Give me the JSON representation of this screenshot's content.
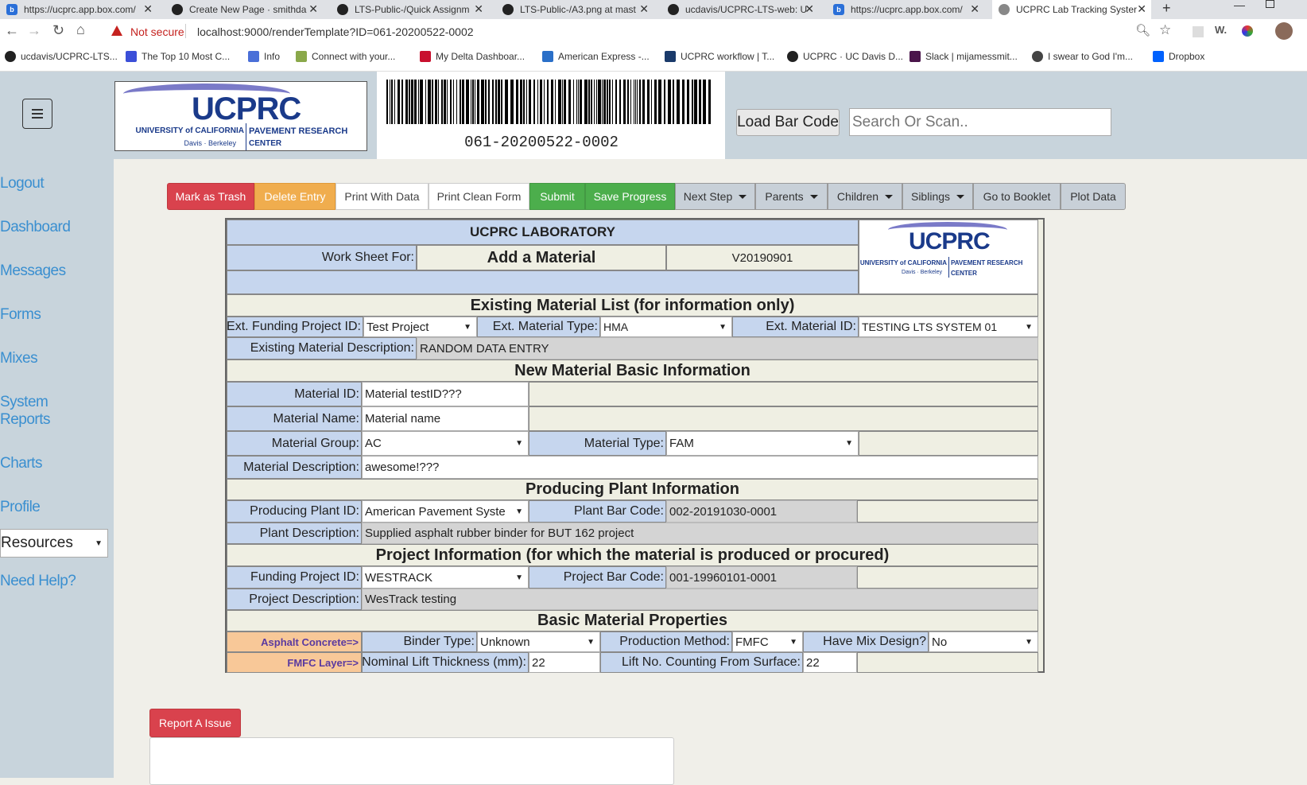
{
  "browser": {
    "tabs": [
      {
        "label": "https://ucprc.app.box.com/",
        "icon": "box-icon"
      },
      {
        "label": "Create New Page · smithda",
        "icon": "github-icon"
      },
      {
        "label": "LTS-Public-/Quick Assignm",
        "icon": "github-icon"
      },
      {
        "label": "LTS-Public-/A3.png at mast",
        "icon": "github-icon"
      },
      {
        "label": "ucdavis/UCPRC-LTS-web: U",
        "icon": "github-icon"
      },
      {
        "label": "https://ucprc.app.box.com/",
        "icon": "box-icon"
      },
      {
        "label": "UCPRC Lab Tracking Syster",
        "icon": "globe-icon"
      }
    ],
    "security_label": "Not secure",
    "url": "localhost:9000/renderTemplate?ID=061-20200522-0002",
    "bookmarks": [
      {
        "label": "ucdavis/UCPRC-LTS...",
        "color": "#222"
      },
      {
        "label": "The Top 10 Most C...",
        "color": "#3b4fd8"
      },
      {
        "label": "Info",
        "color": "#4a6fd8"
      },
      {
        "label": "Connect with your...",
        "color": "#6a8a2a"
      },
      {
        "label": "My Delta Dashboar...",
        "color": "#c8102e"
      },
      {
        "label": "American Express -...",
        "color": "#2a6fc8"
      },
      {
        "label": "UCPRC workflow | T...",
        "color": "#1a3a6a"
      },
      {
        "label": "UCPRC · UC Davis D...",
        "color": "#222"
      },
      {
        "label": "Slack | mijamessmit...",
        "color": "#4a154b"
      },
      {
        "label": "I swear to God I'm...",
        "color": "#222"
      },
      {
        "label": "Dropbox",
        "color": "#0061fe"
      }
    ]
  },
  "header": {
    "logo_top": "UCPRC",
    "logo_left": "UNIVERSITY of CALIFORNIA",
    "logo_left2": "Davis · Berkeley",
    "logo_right": "PAVEMENT RESEARCH",
    "logo_right2": "CENTER",
    "barcode_text": "061-20200522-0002",
    "load_button": "Load Bar Code",
    "search_placeholder": "Search Or Scan.."
  },
  "sidebar": {
    "items": [
      "Logout",
      "Dashboard",
      "Messages",
      "Forms",
      "Mixes",
      "System Reports",
      "Charts",
      "Profile"
    ],
    "resources_select": "Resources",
    "help": "Need Help?"
  },
  "toolbar": {
    "mark_trash": "Mark as Trash",
    "delete": "Delete Entry",
    "print_data": "Print With Data",
    "print_clean": "Print Clean Form",
    "submit": "Submit",
    "save": "Save Progress",
    "next_step": "Next Step",
    "parents": "Parents",
    "children": "Children",
    "siblings": "Siblings",
    "booklet": "Go to Booklet",
    "plot": "Plot Data"
  },
  "form": {
    "lab_title": "UCPRC LABORATORY",
    "worksheet_label": "Work Sheet For:",
    "worksheet_value": "Add a Material",
    "version": "V20190901",
    "existing_header": "Existing Material List (for information only)",
    "ext_funding_label": "Ext. Funding Project ID:",
    "ext_funding_value": "Test Project",
    "ext_type_label": "Ext. Material Type:",
    "ext_type_value": "HMA",
    "ext_id_label": "Ext. Material ID:",
    "ext_id_value": "TESTING LTS SYSTEM 01",
    "existing_desc_label": "Existing Material Description:",
    "existing_desc_value": "RANDOM DATA ENTRY",
    "new_header": "New Material Basic Information",
    "material_id_label": "Material ID:",
    "material_id_value": "Material testID???",
    "material_name_label": "Material Name:",
    "material_name_value": "Material name",
    "material_group_label": "Material Group:",
    "material_group_value": "AC",
    "material_type_label": "Material Type:",
    "material_type_value": "FAM",
    "material_desc_label": "Material Description:",
    "material_desc_value": "awesome!???",
    "plant_header": "Producing Plant Information",
    "plant_id_label": "Producing Plant ID:",
    "plant_id_value": "American Pavement Syste",
    "plant_barcode_label": "Plant Bar Code:",
    "plant_barcode_value": "002-20191030-0001",
    "plant_desc_label": "Plant Description:",
    "plant_desc_value": "Supplied asphalt rubber binder for BUT 162 project",
    "project_header": "Project Information (for which the material is produced or procured)",
    "funding_id_label": "Funding Project ID:",
    "funding_id_value": "WESTRACK",
    "project_barcode_label": "Project Bar Code:",
    "project_barcode_value": "001-19960101-0001",
    "project_desc_label": "Project Description:",
    "project_desc_value": "WesTrack testing",
    "props_header": "Basic Material Properties",
    "ac_label": "Asphalt Concrete=>",
    "binder_label": "Binder Type:",
    "binder_value": "Unknown",
    "prod_method_label": "Production Method:",
    "prod_method_value": "FMFC",
    "mix_design_label": "Have Mix Design?",
    "mix_design_value": "No",
    "fmfc_label": "FMFC Layer=>",
    "lift_thickness_label": "Nominal Lift Thickness (mm):",
    "lift_thickness_value": "22",
    "lift_no_label": "Lift No. Counting From Surface:",
    "lift_no_value": "22"
  },
  "report_issue": "Report A Issue"
}
